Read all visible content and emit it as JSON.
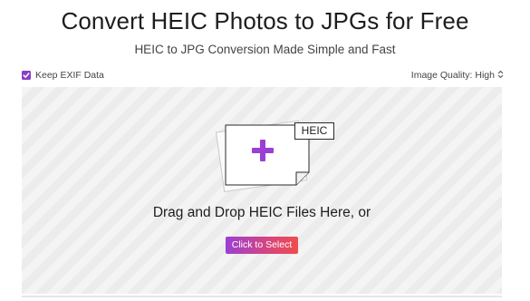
{
  "header": {
    "title": "Convert HEIC Photos to JPGs for Free",
    "subtitle": "HEIC to JPG Conversion Made Simple and Fast"
  },
  "options": {
    "keep_exif": {
      "label": "Keep EXIF Data",
      "checked": true,
      "icon": "checkbox-checked-icon"
    },
    "image_quality": {
      "label": "Image Quality: High",
      "icon": "chevron-updown-icon"
    }
  },
  "dropzone": {
    "file_badge": "HEIC",
    "plus_icon": "plus-icon",
    "instruction": "Drag and Drop HEIC Files Here, or",
    "select_button": "Click to Select"
  },
  "colors": {
    "accent_purple": "#8a3fc7",
    "button_gradient_start": "#9b3fd6",
    "button_gradient_end": "#ee4d4d",
    "dropzone_bg": "#f2f2f2"
  }
}
